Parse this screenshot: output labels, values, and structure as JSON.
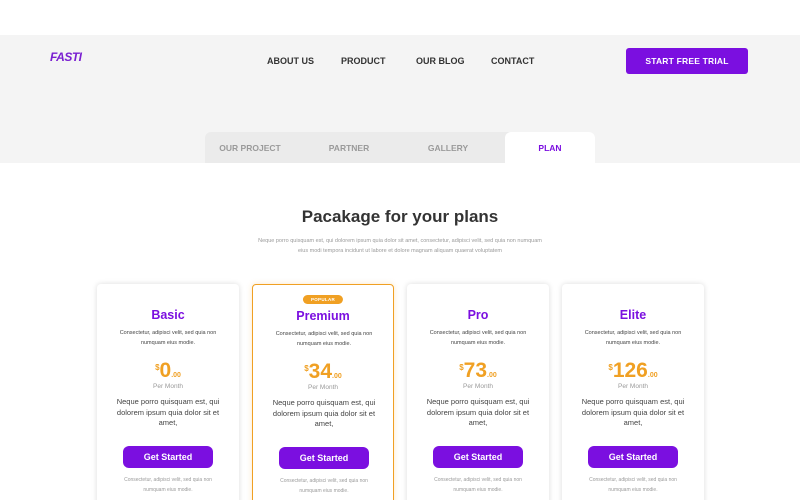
{
  "brand": {
    "logo": "FASTI",
    "accent": "#7b0fe0",
    "highlight": "#f0a023"
  },
  "nav": {
    "items": [
      "ABOUT US",
      "PRODUCT",
      "OUR BLOG",
      "CONTACT"
    ],
    "cta": "START FREE TRIAL"
  },
  "tabs": {
    "items": [
      "OUR PROJECT",
      "PARTNER",
      "GALLERY",
      "PLAN"
    ],
    "active": "PLAN"
  },
  "section": {
    "title": "Pacakage for your plans",
    "subtitle": "Neque porro quisquam est, qui dolorem ipsum quia dolor sit amet, consectetur, adipisci velit, sed quia non numquam eius modi tempora incidunt ut labore et dolore magnam aliquam quaerat voluptatem"
  },
  "plans": [
    {
      "name": "Basic",
      "description": "Consectetur, adipisci velit, sed quia non numquam eius modie.",
      "currency": "$",
      "price": "0",
      "cents": ".00",
      "period": "Per Month",
      "features": "Neque porro quisquam est, qui dolorem ipsum quia dolor sit et amet,",
      "button": "Get Started",
      "footnote": "Consectetur, adipisci velit, sed quia non numquam eius modie.",
      "featured": false
    },
    {
      "name": "Premium",
      "badge": "POPULAR",
      "description": "Consectetur, adipisci velit, sed quia non numquam eius modie.",
      "currency": "$",
      "price": "34",
      "cents": ".00",
      "period": "Per Month",
      "features": "Neque porro quisquam est, qui dolorem ipsum quia dolor sit et amet,",
      "button": "Get Started",
      "footnote": "Consectetur, adipisci velit, sed quia non numquam eius modie.",
      "featured": true
    },
    {
      "name": "Pro",
      "description": "Consectetur, adipisci velit, sed quia non numquam eius modie.",
      "currency": "$",
      "price": "73",
      "cents": ".00",
      "period": "Per Month",
      "features": "Neque porro quisquam est, qui dolorem ipsum quia dolor sit et amet,",
      "button": "Get Started",
      "footnote": "Consectetur, adipisci velit, sed quia non numquam eius modie.",
      "featured": false
    },
    {
      "name": "Elite",
      "description": "Consectetur, adipisci velit, sed quia non numquam eius modie.",
      "currency": "$",
      "price": "126",
      "cents": ".00",
      "period": "Per Month",
      "features": "Neque porro quisquam est, qui dolorem ipsum quia dolor sit et amet,",
      "button": "Get Started",
      "footnote": "Consectetur, adipisci velit, sed quia non numquam eius modie.",
      "featured": false
    }
  ]
}
